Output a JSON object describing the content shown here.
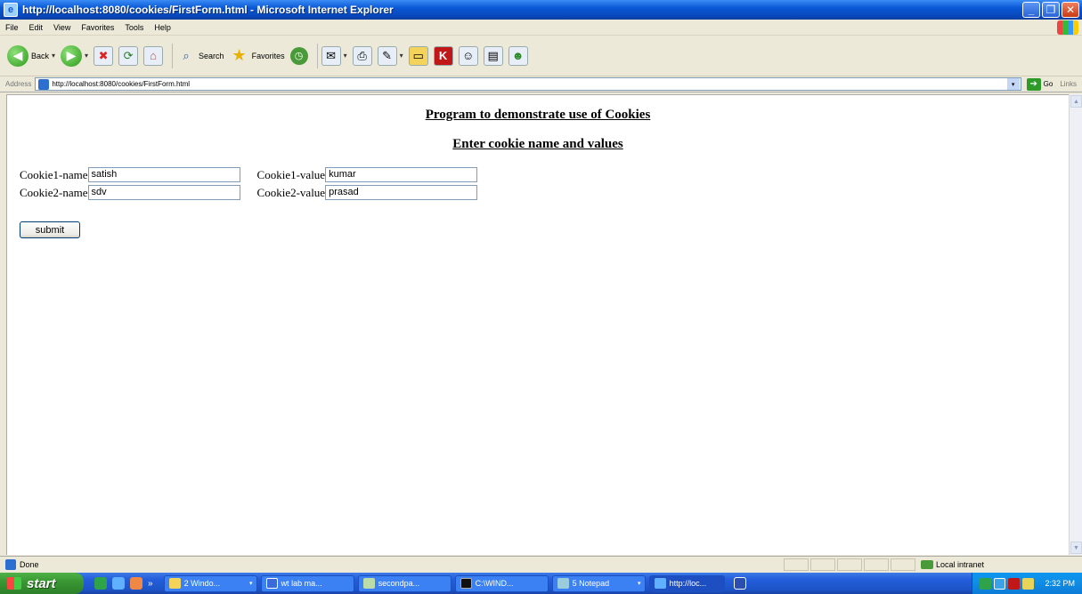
{
  "window": {
    "title": "http://localhost:8080/cookies/FirstForm.html - Microsoft Internet Explorer",
    "controls": [
      "_",
      "❐",
      "✕"
    ]
  },
  "menu": [
    "File",
    "Edit",
    "View",
    "Favorites",
    "Tools",
    "Help"
  ],
  "toolbar": {
    "back_label": "Back",
    "search_label": "Search",
    "favorites_label": "Favorites"
  },
  "address": {
    "label": "Address",
    "url": "http://localhost:8080/cookies/FirstForm.html",
    "go_label": "Go",
    "links_label": "Links"
  },
  "page": {
    "heading1": "Program to demonstrate use of Cookies",
    "heading2": "Enter cookie name and values",
    "rows": [
      {
        "name_label": "Cookie1-name",
        "name_value": "satish",
        "value_label": "Cookie1-value",
        "value_value": "kumar"
      },
      {
        "name_label": "Cookie2-name",
        "name_value": "sdv",
        "value_label": "Cookie2-value",
        "value_value": "prasad"
      }
    ],
    "submit_label": "submit"
  },
  "status": {
    "text": "Done",
    "zone": "Local intranet"
  },
  "taskbar": {
    "start_label": "start",
    "tasks": [
      "2 Windo...",
      "wt lab ma...",
      "secondpa...",
      "C:\\WIND...",
      "5 Notepad",
      "http://loc..."
    ],
    "clock": "2:32 PM"
  },
  "colors": {
    "titlebar": "#0a58d6",
    "taskbar": "#245edb",
    "start": "#3a9833",
    "chrome": "#ece9d8"
  }
}
